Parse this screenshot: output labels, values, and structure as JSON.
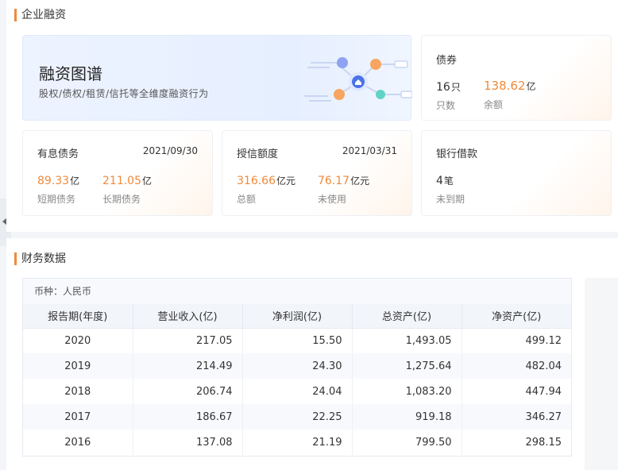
{
  "financing": {
    "title": "企业融资",
    "banner": {
      "title": "融资图谱",
      "subtitle": "股权/债权/租赁/信托等全维度融资行为"
    },
    "bonds": {
      "title": "债券",
      "count_value": "16",
      "count_unit": "只",
      "count_label": "只数",
      "balance_value": "138.62",
      "balance_unit": "亿",
      "balance_label": "余额"
    },
    "interest_debt": {
      "title": "有息债务",
      "date": "2021/09/30",
      "short_value": "89.33",
      "short_unit": "亿",
      "short_label": "短期债务",
      "long_value": "211.05",
      "long_unit": "亿",
      "long_label": "长期债务"
    },
    "credit": {
      "title": "授信额度",
      "date": "2021/03/31",
      "total_value": "316.66",
      "total_unit": "亿元",
      "total_label": "总额",
      "unused_value": "76.17",
      "unused_unit": "亿元",
      "unused_label": "未使用"
    },
    "bank_loan": {
      "title": "银行借款",
      "count_value": "4",
      "count_unit": "笔",
      "count_label": "未到期"
    }
  },
  "financial": {
    "title": "财务数据",
    "currency": "币种：人民币",
    "columns": [
      "报告期(年度)",
      "营业收入(亿)",
      "净利润(亿)",
      "总资产(亿)",
      "净资产(亿)"
    ],
    "rows": [
      [
        "2020",
        "217.05",
        "15.50",
        "1,493.05",
        "499.12"
      ],
      [
        "2019",
        "214.49",
        "24.30",
        "1,275.64",
        "482.04"
      ],
      [
        "2018",
        "206.74",
        "24.04",
        "1,083.20",
        "447.94"
      ],
      [
        "2017",
        "186.67",
        "22.25",
        "919.18",
        "346.27"
      ],
      [
        "2016",
        "137.08",
        "21.19",
        "799.50",
        "298.15"
      ]
    ]
  },
  "colors": {
    "accent": "#f08a3a",
    "node_blue": "#8fa3f2",
    "node_orange": "#f7a560",
    "node_teal": "#5fd4c6",
    "center": "#4a72e8"
  }
}
